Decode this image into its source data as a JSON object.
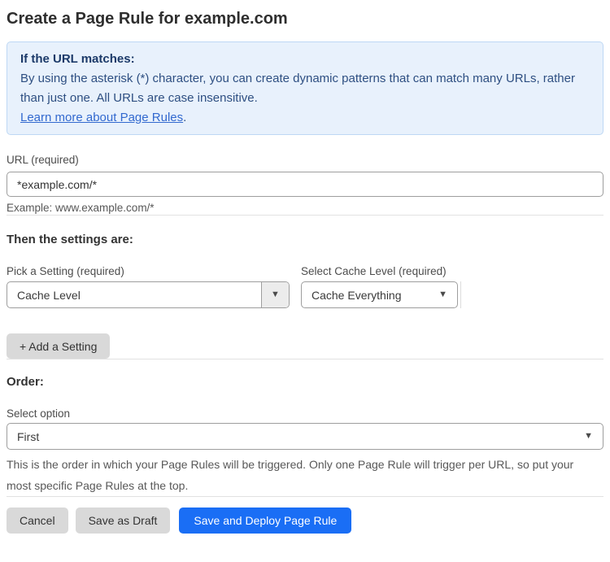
{
  "page": {
    "title": "Create a Page Rule for example.com"
  },
  "info_box": {
    "heading": "If the URL matches:",
    "body": "By using the asterisk (*) character, you can create dynamic patterns that can match many URLs, rather than just one. All URLs are case insensitive.",
    "link_label": "Learn more about Page Rules",
    "link_suffix": "."
  },
  "url_field": {
    "label": "URL (required)",
    "value": "*example.com/*",
    "helper": "Example: www.example.com/*"
  },
  "settings": {
    "heading": "Then the settings are:",
    "pick_setting": {
      "label": "Pick a Setting (required)",
      "value": "Cache Level"
    },
    "cache_level": {
      "label": "Select Cache Level (required)",
      "value": "Cache Everything"
    },
    "add_button_label": "+ Add a Setting"
  },
  "order": {
    "heading": "Order:",
    "select_label": "Select option",
    "value": "First",
    "helper": "This is the order in which your Page Rules will be triggered. Only one Page Rule will trigger per URL, so put your most specific Page Rules at the top."
  },
  "actions": {
    "cancel": "Cancel",
    "save_draft": "Save as Draft",
    "save_deploy": "Save and Deploy Page Rule"
  },
  "icons": {
    "dropdown_arrow": "▼"
  },
  "colors": {
    "info_background": "#e8f1fc",
    "info_border": "#bed8f4",
    "info_heading_text": "#1c3a69",
    "info_body_text": "#2e4f82",
    "link_blue": "#3269cf",
    "primary_button_blue": "#1a6ef5",
    "gray_button": "#d9d9d9"
  }
}
